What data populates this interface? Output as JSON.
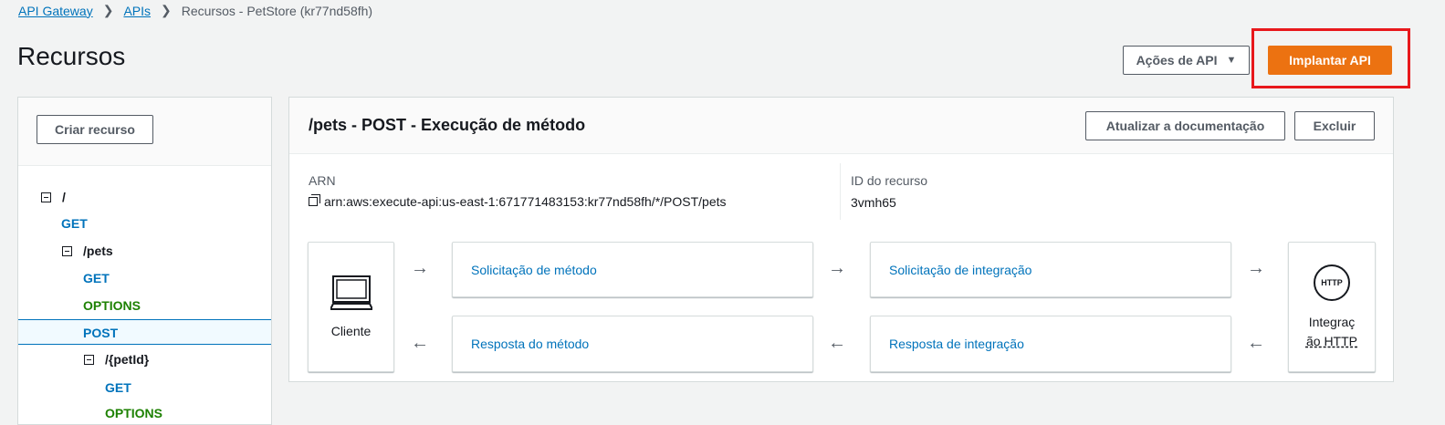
{
  "breadcrumb": {
    "items": [
      "API Gateway",
      "APIs"
    ],
    "current": "Recursos - PetStore (kr77nd58fh)"
  },
  "header": {
    "title": "Recursos",
    "api_actions_label": "Ações de API",
    "deploy_label": "Implantar API"
  },
  "sidebar": {
    "create_label": "Criar recurso",
    "tree": [
      {
        "label": "/",
        "kind": "resource"
      },
      {
        "label": "GET",
        "kind": "method"
      },
      {
        "label": "/pets",
        "kind": "resource"
      },
      {
        "label": "GET",
        "kind": "method"
      },
      {
        "label": "OPTIONS",
        "kind": "options"
      },
      {
        "label": "POST",
        "kind": "method",
        "selected": true
      },
      {
        "label": "/{petId}",
        "kind": "resource"
      },
      {
        "label": "GET",
        "kind": "method"
      },
      {
        "label": "OPTIONS",
        "kind": "options"
      }
    ]
  },
  "main": {
    "title": "/pets - POST - Execução de método",
    "update_docs_label": "Atualizar a documentação",
    "delete_label": "Excluir",
    "arn_label": "ARN",
    "arn_value": "arn:aws:execute-api:us-east-1:671771483153:kr77nd58fh/*/POST/pets",
    "resource_id_label": "ID do recurso",
    "resource_id_value": "3vmh65",
    "flow": {
      "client_label": "Cliente",
      "method_request": "Solicitação de método",
      "integration_request": "Solicitação de integração",
      "method_response": "Resposta do método",
      "integration_response": "Resposta de integração",
      "http_badge": "HTTP",
      "http_integration_label_1": "Integraç",
      "http_integration_label_2": "ão HTTP"
    }
  },
  "colors": {
    "link": "#0073bb",
    "primary": "#ec7211",
    "options": "#1d8102",
    "highlight": "#e8181c"
  }
}
